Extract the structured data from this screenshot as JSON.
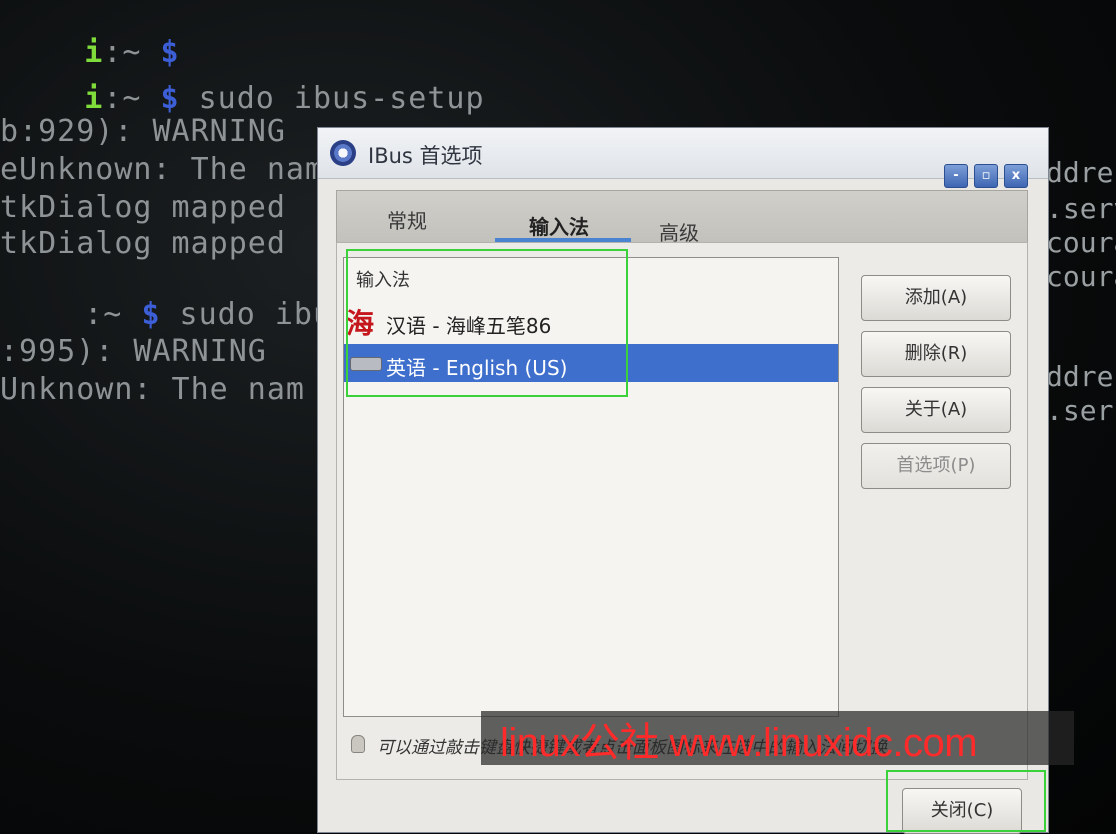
{
  "terminal": {
    "lines": [
      {
        "prompt": "i",
        "sep": ":~ ",
        "dollar": "$",
        "text": ""
      },
      {
        "prompt": "i",
        "sep": ":~ ",
        "dollar": "$",
        "text": " sudo ibus-setup"
      },
      {
        "text": "b:929): WARNING"
      },
      {
        "text": "eUnknown: The nam"
      },
      {
        "text": "tkDialog mapped"
      },
      {
        "text": "tkDialog mapped"
      },
      {
        "prompt": "",
        "sep": ":~ ",
        "dollar": "$",
        "text": " sudo ibus-s"
      },
      {
        "text": ":995): WARNING"
      },
      {
        "text": "Unknown: The nam"
      }
    ],
    "right_lines": [
      "ddres",
      ".serv",
      "coura",
      "coura",
      "ddre",
      ".ser"
    ]
  },
  "dialog": {
    "title": "IBus 首选项",
    "window_buttons": {
      "minimize": "-",
      "maximize": "▫",
      "close": "x"
    },
    "tabs": [
      {
        "label": "常规",
        "active": false
      },
      {
        "label": "输入法",
        "active": true
      },
      {
        "label": "高级",
        "active": false
      }
    ],
    "list": {
      "header": "输入法",
      "rows": [
        {
          "icon": "海",
          "label": "汉语 - 海峰五笔86",
          "selected": false
        },
        {
          "icon": "keyboard-icon",
          "label": "英语 - English (US)",
          "selected": true
        }
      ]
    },
    "buttons": {
      "add": "添加(A)",
      "remove": "删除(R)",
      "about": "关于(A)",
      "preferences": "首选项(P)"
    },
    "hint": "可以通过敲击键盘快捷键或者点击面板图标来在选中的输入法间切换",
    "close": "关闭(C)"
  },
  "watermark": "linux公社 www.linuxidc.com",
  "colors": {
    "selection": "#3f6fcc",
    "highlight_box": "#3ad13a",
    "watermark": "#ff2a2a"
  }
}
